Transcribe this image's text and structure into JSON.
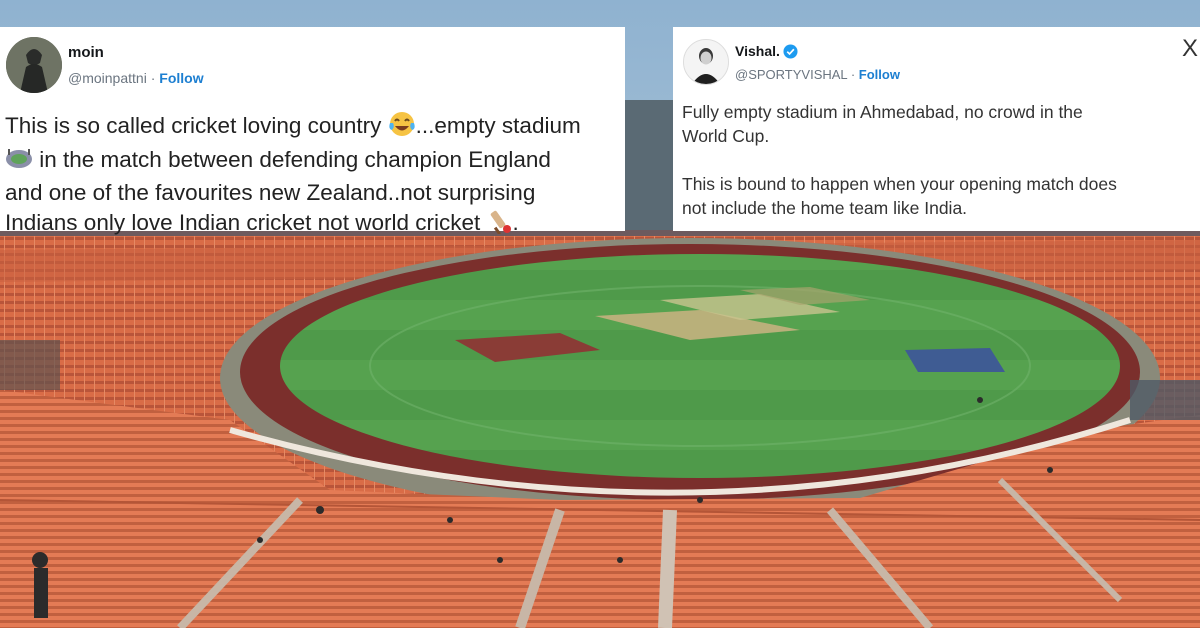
{
  "colors": {
    "follow_link": "#1d7fd1",
    "verified_badge": "#1d9bf0",
    "field_green": "#4d9448",
    "seat_orange": "#e0764f"
  },
  "tweets": [
    {
      "display_name": "moin",
      "handle": "@moinpattni",
      "separator": "·",
      "follow_label": "Follow",
      "body": [
        {
          "type": "text",
          "value": "This is so called cricket loving country "
        },
        {
          "type": "emoji",
          "icon": "tears-of-joy-icon"
        },
        {
          "type": "text",
          "value": "...empty stadium\n"
        },
        {
          "type": "emoji",
          "icon": "stadium-icon"
        },
        {
          "type": "text",
          "value": " in the match between defending champion England\nand one of the favourites new Zealand..not surprising\nIndians only love Indian cricket not world cricket "
        },
        {
          "type": "emoji",
          "icon": "cricket-bat-icon"
        },
        {
          "type": "text",
          "value": "."
        }
      ]
    },
    {
      "display_name": "Vishal.",
      "verified": true,
      "handle": "@SPORTYVISHAL",
      "separator": "·",
      "follow_label": "Follow",
      "close_glyph": "X",
      "body_text": "Fully empty stadium in Ahmedabad, no crowd in the\nWorld Cup.\n\nThis is bound to happen when your opening match does\nnot include the home team like India."
    }
  ]
}
